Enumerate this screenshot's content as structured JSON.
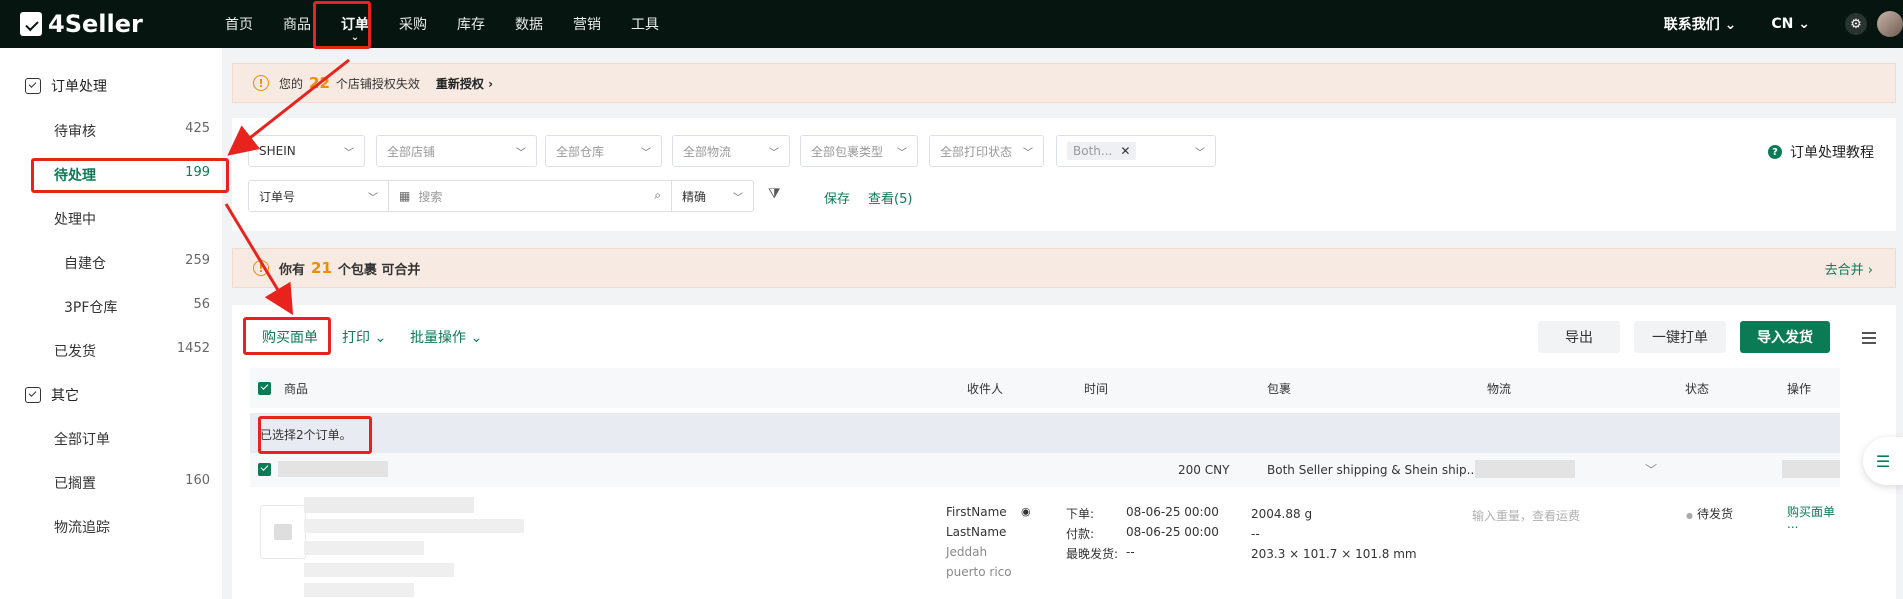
{
  "app": {
    "logo": "4Seller"
  },
  "nav": {
    "items": [
      "首页",
      "商品",
      "订单",
      "采购",
      "库存",
      "数据",
      "营销",
      "工具"
    ],
    "active_index": 2,
    "contact": "联系我们",
    "language": "CN"
  },
  "sidebar": {
    "section1_title": "订单处理",
    "items": [
      {
        "label": "待审核",
        "count": "425"
      },
      {
        "label": "待处理",
        "count": "199"
      },
      {
        "label": "处理中",
        "count": ""
      },
      {
        "label": "自建仓",
        "count": "259"
      },
      {
        "label": "3PF仓库",
        "count": "56"
      },
      {
        "label": "已发货",
        "count": "1452"
      }
    ],
    "section2_title": "其它",
    "items2": [
      {
        "label": "全部订单",
        "count": ""
      },
      {
        "label": "已搁置",
        "count": "160"
      },
      {
        "label": "物流追踪",
        "count": ""
      }
    ]
  },
  "banner_auth": {
    "prefix": "您的",
    "count": "22",
    "suffix": "个店铺授权失效",
    "action": "重新授权"
  },
  "filters": {
    "platform": "SHEIN",
    "store": "全部店铺",
    "warehouse": "全部仓库",
    "logistics": "全部物流",
    "package_type": "全部包裹类型",
    "print_status": "全部打印状态",
    "tag": "Both...",
    "search_type": "订单号",
    "search_placeholder": "搜索",
    "match_mode": "精确",
    "save": "保存",
    "view": "查看(5)",
    "tutorial": "订单处理教程"
  },
  "banner_merge": {
    "prefix": "你有",
    "count": "21",
    "suffix": "个包裹 可合并",
    "action": "去合并"
  },
  "toolbar": {
    "buy_label": "购买面单",
    "print": "打印",
    "batch": "批量操作",
    "export": "导出",
    "one_click_print": "一键打单",
    "import_ship": "导入发货"
  },
  "table": {
    "headers": [
      "商品",
      "收件人",
      "时间",
      "包裹",
      "物流",
      "状态",
      "操作"
    ],
    "selected_text": "已选择2个订单。",
    "order": {
      "amount": "200 CNY",
      "package_desc": "Both Seller shipping & Shein ship...",
      "recipient_first": "FirstName",
      "recipient_last": "LastName",
      "city": "Jeddah",
      "region": "puerto rico",
      "order_time_label": "下单:",
      "order_time": "08-06-25 00:00",
      "pay_time_label": "付款:",
      "pay_time": "08-06-25 00:00",
      "latest_ship_label": "最晚发货:",
      "latest_ship": "--",
      "weight": "2004.88 g",
      "pkg_dash": "--",
      "dimensions": "203.3 × 101.7 × 101.8 mm",
      "logistics_hint": "输入重量，查看运费",
      "status": "待发货",
      "action": "购买面单",
      "more": "..."
    }
  },
  "colors": {
    "brand_green": "#0b7b55",
    "topbar": "#061510",
    "warning_orange": "#f08c00",
    "highlight_red": "#e8231e"
  }
}
